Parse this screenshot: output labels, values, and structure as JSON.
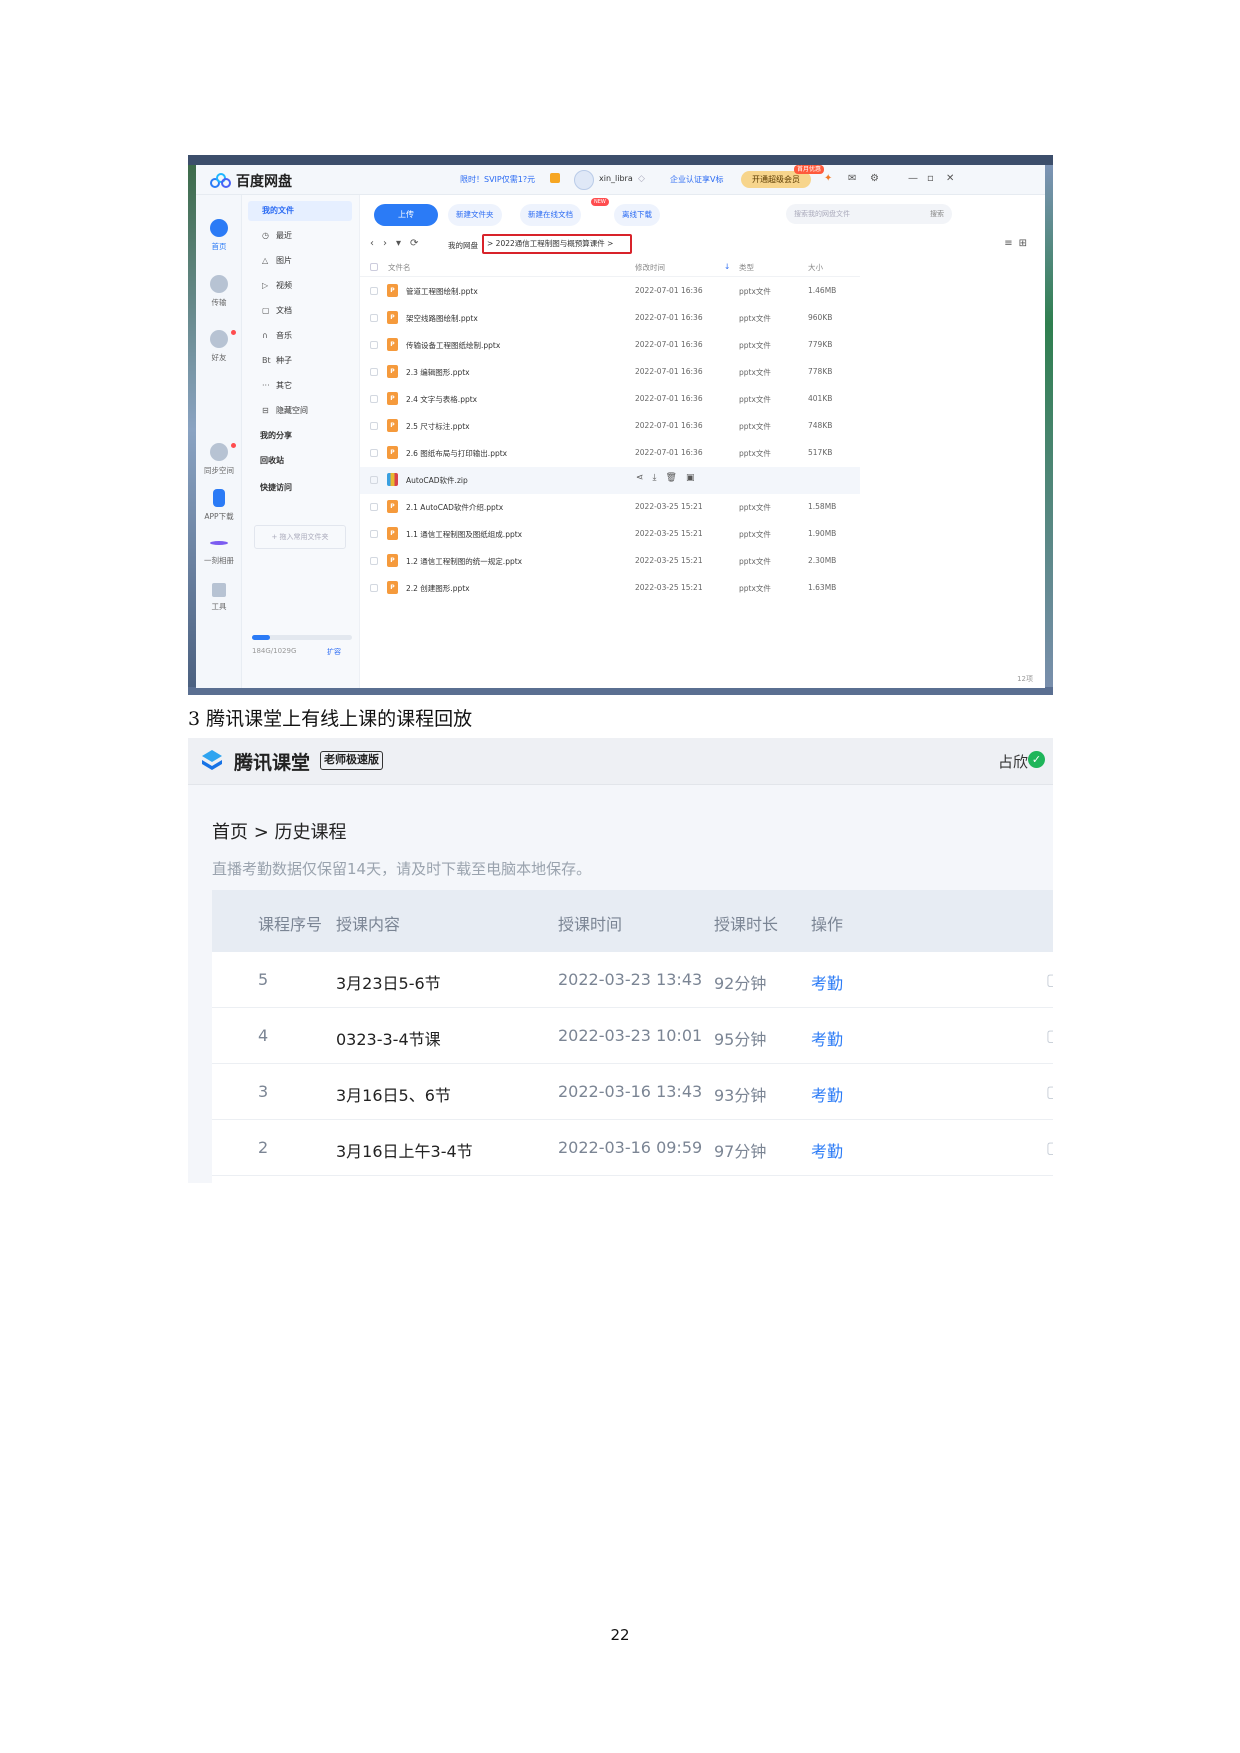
{
  "netdisk": {
    "app_title": "百度网盘",
    "promo": "限时！SVIP仅需1?元",
    "username": "xin_libra",
    "enterprise": "企业认证享V标",
    "vip_button": "开通超级会员",
    "vip_badge": "首月优惠",
    "nav": [
      {
        "label": "首页",
        "icon": "home-icon"
      },
      {
        "label": "传输",
        "icon": "transfer-icon"
      },
      {
        "label": "好友",
        "icon": "friends-icon"
      },
      {
        "label": "同步空间",
        "icon": "sync-icon"
      },
      {
        "label": "APP下载",
        "icon": "phone-icon"
      },
      {
        "label": "一刻相册",
        "icon": "album-icon"
      },
      {
        "label": "工具",
        "icon": "tools-icon"
      }
    ],
    "tree": {
      "head": "我的文件",
      "items": [
        {
          "glyph": "◷",
          "label": "最近"
        },
        {
          "glyph": "△",
          "label": "图片"
        },
        {
          "glyph": "▷",
          "label": "视频"
        },
        {
          "glyph": "▢",
          "label": "文档"
        },
        {
          "glyph": "∩",
          "label": "音乐"
        },
        {
          "glyph": "Bt",
          "label": "种子"
        },
        {
          "glyph": "···",
          "label": "其它"
        },
        {
          "glyph": "⊟",
          "label": "隐藏空间"
        }
      ],
      "share": "我的分享",
      "recycle": "回收站",
      "quick": "快捷访问",
      "add_fav": "+ 拖入常用文件夹",
      "quota": "184G/1029G",
      "expand": "扩容"
    },
    "toolbar": {
      "upload": "上传",
      "new_folder": "新建文件夹",
      "new_online": "新建在线文档",
      "new_badge": "NEW",
      "offline": "离线下载",
      "search_placeholder": "搜索我的网盘文件",
      "search_btn": "搜索"
    },
    "crumb_root": "我的网盘",
    "crumb_path": "> 2022通信工程制图与概预算课件 >",
    "columns": {
      "name": "文件名",
      "date": "修改时间",
      "type": "类型",
      "size": "大小"
    },
    "files": [
      {
        "name": "管道工程图绘制.pptx",
        "date": "2022-07-01 16:36",
        "type": "pptx文件",
        "size": "1.46MB"
      },
      {
        "name": "架空线路图绘制.pptx",
        "date": "2022-07-01 16:36",
        "type": "pptx文件",
        "size": "960KB"
      },
      {
        "name": "传输设备工程图纸绘制.pptx",
        "date": "2022-07-01 16:36",
        "type": "pptx文件",
        "size": "779KB"
      },
      {
        "name": "2.3 编辑图形.pptx",
        "date": "2022-07-01 16:36",
        "type": "pptx文件",
        "size": "778KB"
      },
      {
        "name": "2.4 文字与表格.pptx",
        "date": "2022-07-01 16:36",
        "type": "pptx文件",
        "size": "401KB"
      },
      {
        "name": "2.5 尺寸标注.pptx",
        "date": "2022-07-01 16:36",
        "type": "pptx文件",
        "size": "748KB"
      },
      {
        "name": "2.6 图纸布局与打印输出.pptx",
        "date": "2022-07-01 16:36",
        "type": "pptx文件",
        "size": "517KB"
      },
      {
        "name": "AutoCAD软件.zip",
        "date": "",
        "type": "",
        "size": ""
      },
      {
        "name": "2.1 AutoCAD软件介绍.pptx",
        "date": "2022-03-25 15:21",
        "type": "pptx文件",
        "size": "1.58MB"
      },
      {
        "name": "1.1 通信工程制图及图纸组成.pptx",
        "date": "2022-03-25 15:21",
        "type": "pptx文件",
        "size": "1.90MB"
      },
      {
        "name": "1.2 通信工程制图的统一规定.pptx",
        "date": "2022-03-25 15:21",
        "type": "pptx文件",
        "size": "2.30MB"
      },
      {
        "name": "2.2 创建图形.pptx",
        "date": "2022-03-25 15:21",
        "type": "pptx文件",
        "size": "1.63MB"
      }
    ],
    "count": "12项"
  },
  "caption": "3 腾讯课堂上有线上课的课程回放",
  "classroom": {
    "app_title": "腾讯课堂",
    "badge": "老师极速版",
    "user": "占欣",
    "crumb": "首页 > 历史课程",
    "notice": "直播考勤数据仅保留14天，请及时下载至电脑本地保存。",
    "headers": {
      "no": "课程序号",
      "content": "授课内容",
      "time": "授课时间",
      "duration": "授课时长",
      "op": "操作"
    },
    "rows": [
      {
        "no": "5",
        "content": "3月23日5-6节",
        "time": "2022-03-23 13:43",
        "duration": "92分钟",
        "op": "考勤"
      },
      {
        "no": "4",
        "content": "0323-3-4节课",
        "time": "2022-03-23 10:01",
        "duration": "95分钟",
        "op": "考勤"
      },
      {
        "no": "3",
        "content": "3月16日5、6节",
        "time": "2022-03-16 13:43",
        "duration": "93分钟",
        "op": "考勤"
      },
      {
        "no": "2",
        "content": "3月16日上午3-4节",
        "time": "2022-03-16 09:59",
        "duration": "97分钟",
        "op": "考勤"
      }
    ]
  },
  "page_number": "22"
}
